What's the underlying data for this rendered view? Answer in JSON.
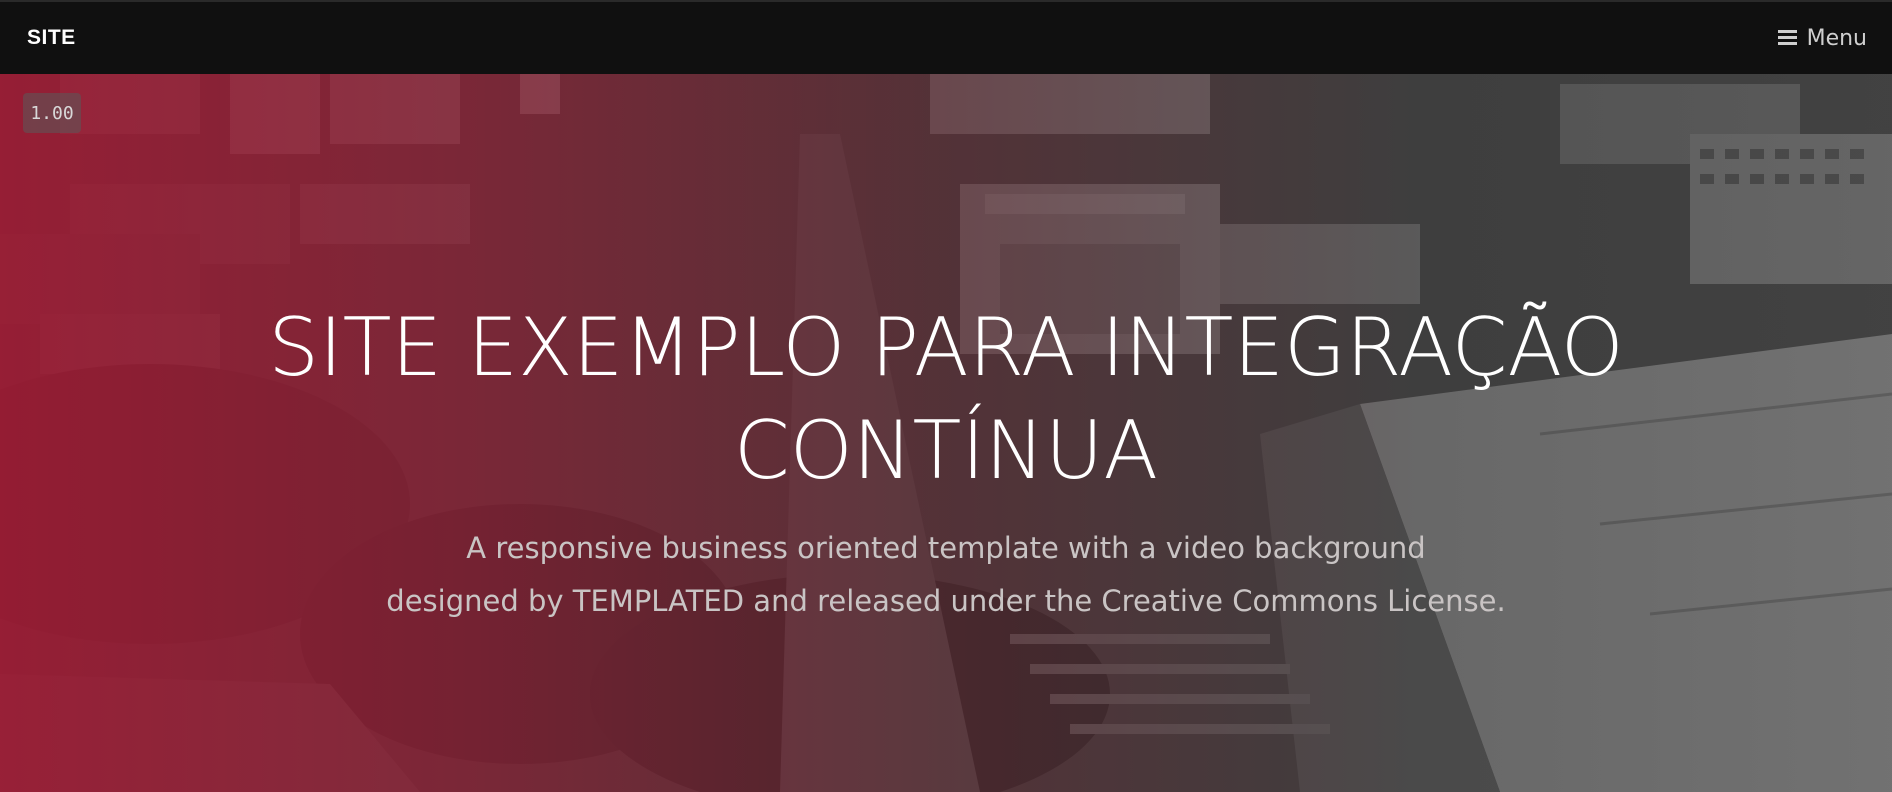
{
  "header": {
    "logo": "SITE",
    "menu_label": "Menu"
  },
  "video": {
    "speed": "1.00"
  },
  "hero": {
    "title_line1": "SITE EXEMPLO PARA INTEGRAÇÃO",
    "title_line2": "CONTÍNUA",
    "subtitle_line1": "A responsive business oriented template with a video background",
    "subtitle_line2": "designed by TEMPLATED and released under the Creative Commons License."
  },
  "colors": {
    "header_bg": "#101010",
    "overlay_red": "#a01832",
    "title_text": "#ffffff",
    "subtitle_text": "#c9c4c4"
  },
  "icons": {
    "menu": "hamburger-menu-icon"
  }
}
